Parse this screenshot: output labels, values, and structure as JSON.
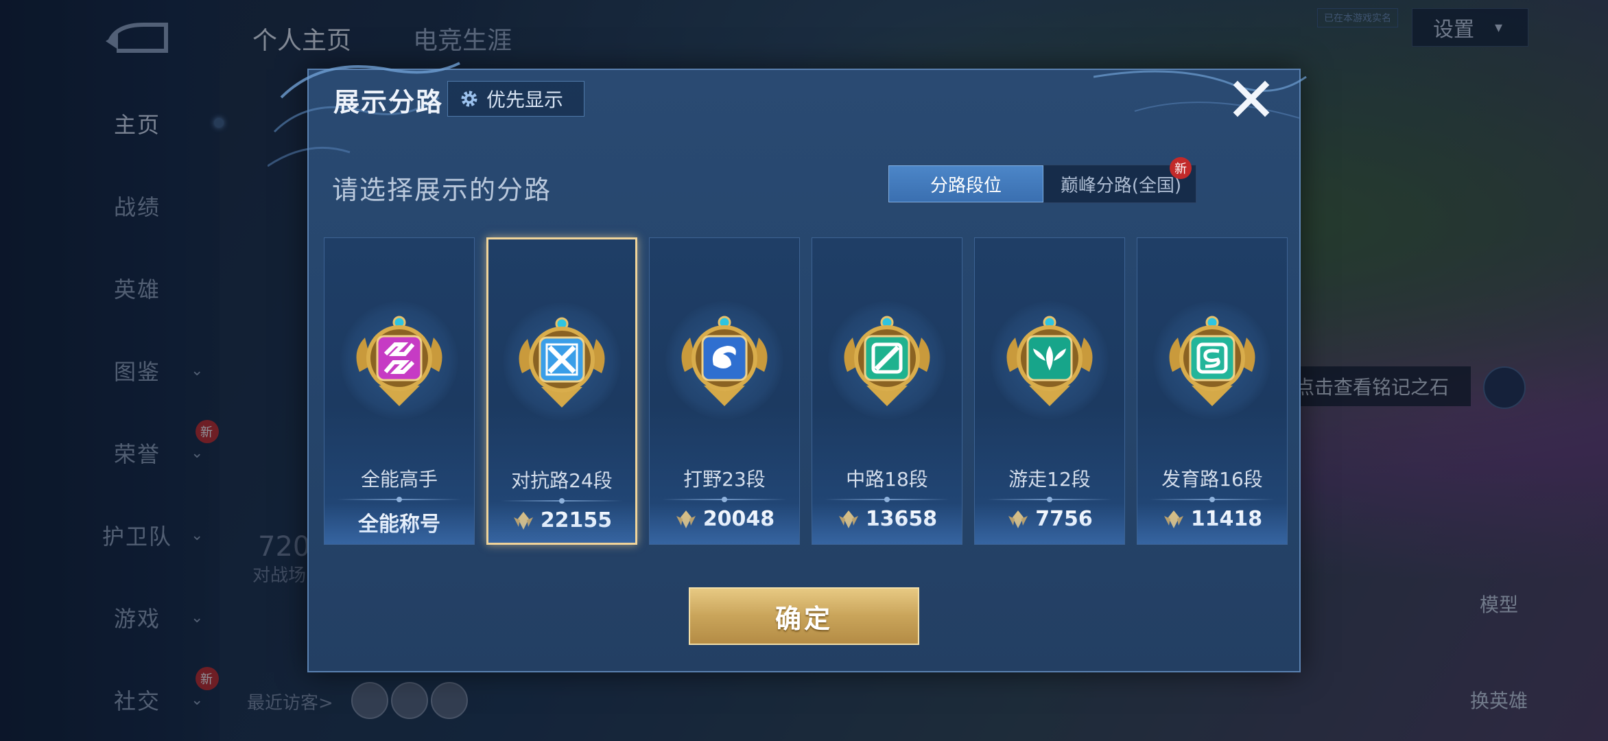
{
  "background": {
    "nav": {
      "items": [
        {
          "label": "主页",
          "active": true,
          "chevron": false,
          "new": false
        },
        {
          "label": "战绩",
          "active": false,
          "chevron": false,
          "new": false
        },
        {
          "label": "英雄",
          "active": false,
          "chevron": false,
          "new": false
        },
        {
          "label": "图鉴",
          "active": false,
          "chevron": true,
          "new": false
        },
        {
          "label": "荣誉",
          "active": false,
          "chevron": true,
          "new": true
        },
        {
          "label": "护卫队",
          "active": false,
          "chevron": true,
          "new": false
        },
        {
          "label": "游戏",
          "active": false,
          "chevron": true,
          "new": false
        },
        {
          "label": "社交",
          "active": false,
          "chevron": true,
          "new": true
        }
      ],
      "chevron_glyph": "⌄",
      "new_badge": "新"
    },
    "tabs": {
      "profile": "个人主页",
      "esports": "电竞生涯"
    },
    "settings_label": "设置",
    "realname_badge": "已在本游戏实名",
    "inscription_hint": "点击查看铭记之石",
    "model_label": "模型",
    "switch_hero_label": "换英雄",
    "recent_visitors_label": "最近访客>",
    "stat_value": "720",
    "stat_label": "对战场"
  },
  "modal": {
    "title": "展示分路",
    "priority_button_label": "优先显示",
    "prompt": "请选择展示的分路",
    "toggle": {
      "lane_rank_label": "分路段位",
      "peak_lane_label": "巅峰分路(全国)",
      "new_badge": "新"
    },
    "cards": [
      {
        "name": "全能高手",
        "value": "全能称号",
        "show_rank_icon": false,
        "selected": false,
        "color": "#c63bc4",
        "symbol": "all"
      },
      {
        "name": "对抗路24段",
        "value": "22155",
        "show_rank_icon": true,
        "selected": true,
        "color": "#3a9ee8",
        "symbol": "clash"
      },
      {
        "name": "打野23段",
        "value": "20048",
        "show_rank_icon": true,
        "selected": false,
        "color": "#2f6fd0",
        "symbol": "jungle"
      },
      {
        "name": "中路18段",
        "value": "13658",
        "show_rank_icon": true,
        "selected": false,
        "color": "#1fb28f",
        "symbol": "mid"
      },
      {
        "name": "游走12段",
        "value": "7756",
        "show_rank_icon": true,
        "selected": false,
        "color": "#17a58a",
        "symbol": "roam"
      },
      {
        "name": "发育路16段",
        "value": "11418",
        "show_rank_icon": true,
        "selected": false,
        "color": "#22b59a",
        "symbol": "farm"
      }
    ],
    "confirm_label": "确定"
  }
}
